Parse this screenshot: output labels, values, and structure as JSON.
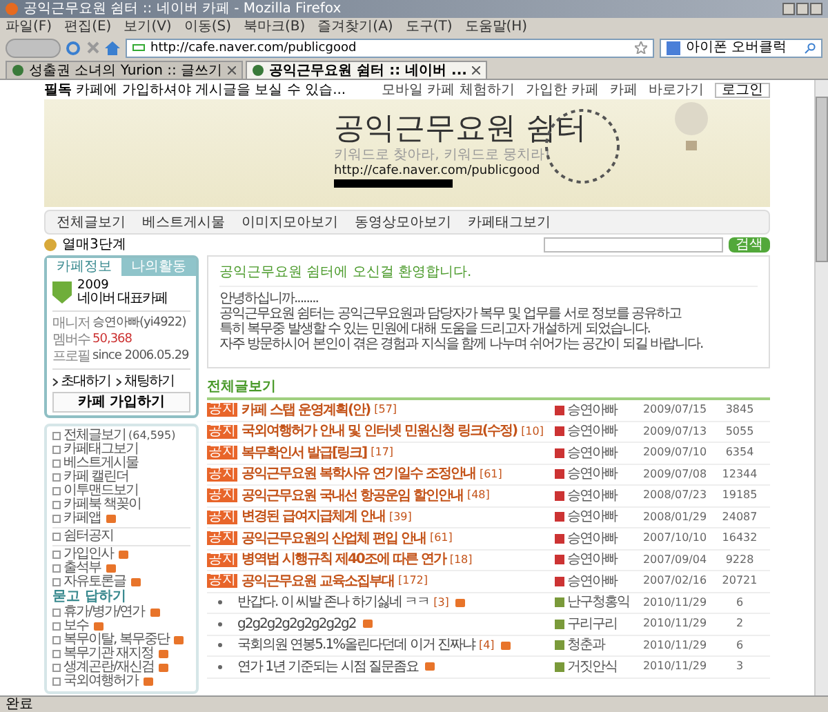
{
  "browser": {
    "title": "공익근무요원 쉼터 :: 네이버 카페 - Mozilla Firefox",
    "menu": [
      "파일(F)",
      "편집(E)",
      "보기(V)",
      "이동(S)",
      "북마크(B)",
      "즐겨찾기(A)",
      "도구(T)",
      "도움말(H)"
    ],
    "url": "http://cafe.naver.com/publicgood",
    "search_value": "아이폰 오버클럭",
    "tabs": [
      {
        "label": "성출권 소녀의 Yurion :: 글쓰기",
        "selected": false
      },
      {
        "label": "공익근무요원 쉼터 :: 네이버 ...",
        "selected": true
      }
    ],
    "status": "완료"
  },
  "cafe": {
    "notice": "**필독** 카페에 가입하셔야 게시글을 보실 수 있습...",
    "top_links": [
      "모바일 카페 체험하기",
      "가입한 카페",
      "카페",
      "바로가기"
    ],
    "login": "로그인",
    "banner": {
      "title": "공익근무요원 쉼터",
      "slogan": "키워드로 찾아라, 키워드로 뭉치라!",
      "url": "http://cafe.naver.com/publicgood"
    },
    "menu": [
      "전체글보기",
      "베스트게시물",
      "이미지모아보기",
      "동영상모아보기",
      "카페태그보기"
    ],
    "level": "열매3단계",
    "search_button": "검색",
    "sidebar": {
      "tabs": [
        {
          "label": "카페정보",
          "selected": true
        },
        {
          "label": "나의활동",
          "selected": false
        }
      ],
      "award_year": "2009",
      "award_label": "네이버 대표카페",
      "info": [
        {
          "label": "매니저",
          "value": "승연아빠(yi4922)"
        },
        {
          "label": "멤버수",
          "value": "50,368"
        },
        {
          "label": "프로필",
          "value": "since 2006.05.29"
        }
      ],
      "links": [
        "초대하기",
        "채팅하기"
      ],
      "join": "카페 가입하기",
      "groups": [
        {
          "items": [
            {
              "label": "전체글보기",
              "count": "(64,595)",
              "new": false
            },
            {
              "label": "카페태그보기",
              "new": false
            },
            {
              "label": "베스트게시물",
              "new": false
            },
            {
              "label": "카페 캘린더",
              "new": false
            },
            {
              "label": "이투맨드보기",
              "new": false
            },
            {
              "label": "카페북 책꽂이",
              "new": false
            },
            {
              "label": "카페앱",
              "new": true
            }
          ]
        },
        {
          "items": [
            {
              "label": "쉼터공지",
              "new": false
            }
          ]
        },
        {
          "items": [
            {
              "label": "가입인사",
              "new": true
            },
            {
              "label": "출석부",
              "new": true
            },
            {
              "label": "자유토론글",
              "new": true
            }
          ]
        },
        {
          "title": "묻고 답하기",
          "items": [
            {
              "label": "휴가/병가/연가",
              "new": true
            },
            {
              "label": "보수",
              "new": true
            },
            {
              "label": "복무이탈, 복무중단",
              "new": true
            },
            {
              "label": "복무기관 재지정",
              "new": true
            },
            {
              "label": "생계곤란/재신검",
              "new": true
            },
            {
              "label": "국외여행허가",
              "new": true
            }
          ]
        }
      ]
    },
    "welcome": {
      "title": "공익근무요원 쉼터에 오신걸 환영합니다.",
      "lines": [
        "안녕하십니까........",
        "공익근무요원 쉼터는 공익근무요원과 담당자가 복무 및 업무를 서로 정보를 공유하고",
        "특히 복무중 발생할 수 있는 민원에 대해 도움을 드리고자 개설하게 되었습니다.",
        "자주 방문하시어 본인이 겪은 경험과 지식을 함께 나누며 쉬어가는 공간이 되길 바랍니다."
      ]
    },
    "board": {
      "title": "전체글보기",
      "posts": [
        {
          "kind": "notice",
          "badge": "공지",
          "title": "카페 스탭 운영계획(안)",
          "comments": "[57]",
          "new": false,
          "author": "승연아빠",
          "date": "2009/07/15",
          "views": "3845"
        },
        {
          "kind": "notice",
          "badge": "공지",
          "title": "국외여행허가 안내 및 인터넷 민원신청 링크(수정)",
          "comments": "[10]",
          "new": false,
          "author": "승연아빠",
          "date": "2009/07/13",
          "views": "5055"
        },
        {
          "kind": "notice",
          "badge": "공지",
          "title": "복무확인서 발급[링크]",
          "comments": "[17]",
          "new": false,
          "author": "승연아빠",
          "date": "2009/07/10",
          "views": "6354"
        },
        {
          "kind": "notice",
          "badge": "공지",
          "title": "공익근무요원 복학사유 연기일수 조정안내",
          "comments": "[61]",
          "new": false,
          "author": "승연아빠",
          "date": "2009/07/08",
          "views": "12344"
        },
        {
          "kind": "notice",
          "badge": "공지",
          "title": "공익근무요원 국내선 항공운임 할인안내",
          "comments": "[48]",
          "new": false,
          "author": "승연아빠",
          "date": "2008/07/23",
          "views": "19185"
        },
        {
          "kind": "notice",
          "badge": "공지",
          "title": "변경된 급여지급체계 안내",
          "comments": "[39]",
          "new": false,
          "author": "승연아빠",
          "date": "2008/01/29",
          "views": "24087"
        },
        {
          "kind": "notice",
          "badge": "공지",
          "title": "공익근무요원의 산업체 편입 안내",
          "comments": "[61]",
          "new": false,
          "author": "승연아빠",
          "date": "2007/10/10",
          "views": "16432"
        },
        {
          "kind": "notice",
          "badge": "공지",
          "title": "병역법 시행규칙 제40조에 따른 연가",
          "comments": "[18]",
          "new": false,
          "author": "승연아빠",
          "date": "2007/09/04",
          "views": "9228"
        },
        {
          "kind": "notice",
          "badge": "공지",
          "title": "공익근무요원 교육소집부대",
          "comments": "[172]",
          "new": false,
          "author": "승연아빠",
          "date": "2007/02/16",
          "views": "20721"
        },
        {
          "kind": "post",
          "title": "반갑다. 이 씨발 존나 하기싫네 ㅋㅋ",
          "comments": "[3]",
          "new": true,
          "author": "난구청홍익",
          "date": "2010/11/29",
          "views": "6"
        },
        {
          "kind": "post",
          "title": "g2g2g2g2g2g2g2g2",
          "new": true,
          "author": "구리구리",
          "date": "2010/11/29",
          "views": "2"
        },
        {
          "kind": "post",
          "title": "국회의원 연봉5.1%올린다던데 이거 진짜냐",
          "comments": "[4]",
          "new": true,
          "author": "청춘과",
          "date": "2010/11/29",
          "views": "6"
        },
        {
          "kind": "post",
          "title": "연가 1년 기준되는 시점 질문좀요",
          "new": true,
          "author": "거짓안식",
          "date": "2010/11/29",
          "views": "3"
        }
      ]
    }
  }
}
